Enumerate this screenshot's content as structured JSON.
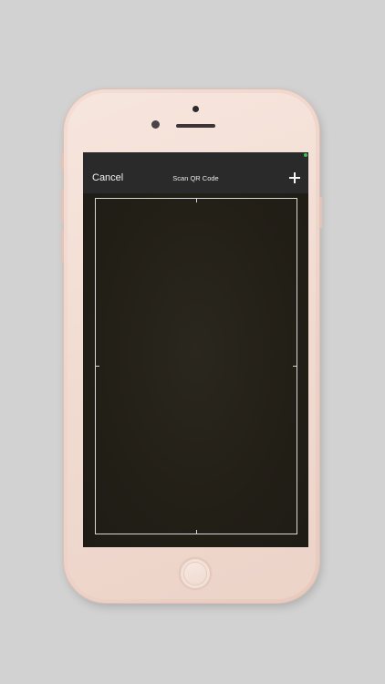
{
  "nav": {
    "cancel_label": "Cancel",
    "title": "Scan QR Code",
    "add_icon": "plus-icon"
  },
  "colors": {
    "nav_background": "#2a2a2a",
    "camera_background": "#232119",
    "frame_stroke": "#d8d8d8",
    "phone_body": "#efd6cc",
    "status_indicator": "#39c152"
  },
  "icons": {
    "status_indicator": "green-dot-icon",
    "home_button": "home-button-icon"
  }
}
